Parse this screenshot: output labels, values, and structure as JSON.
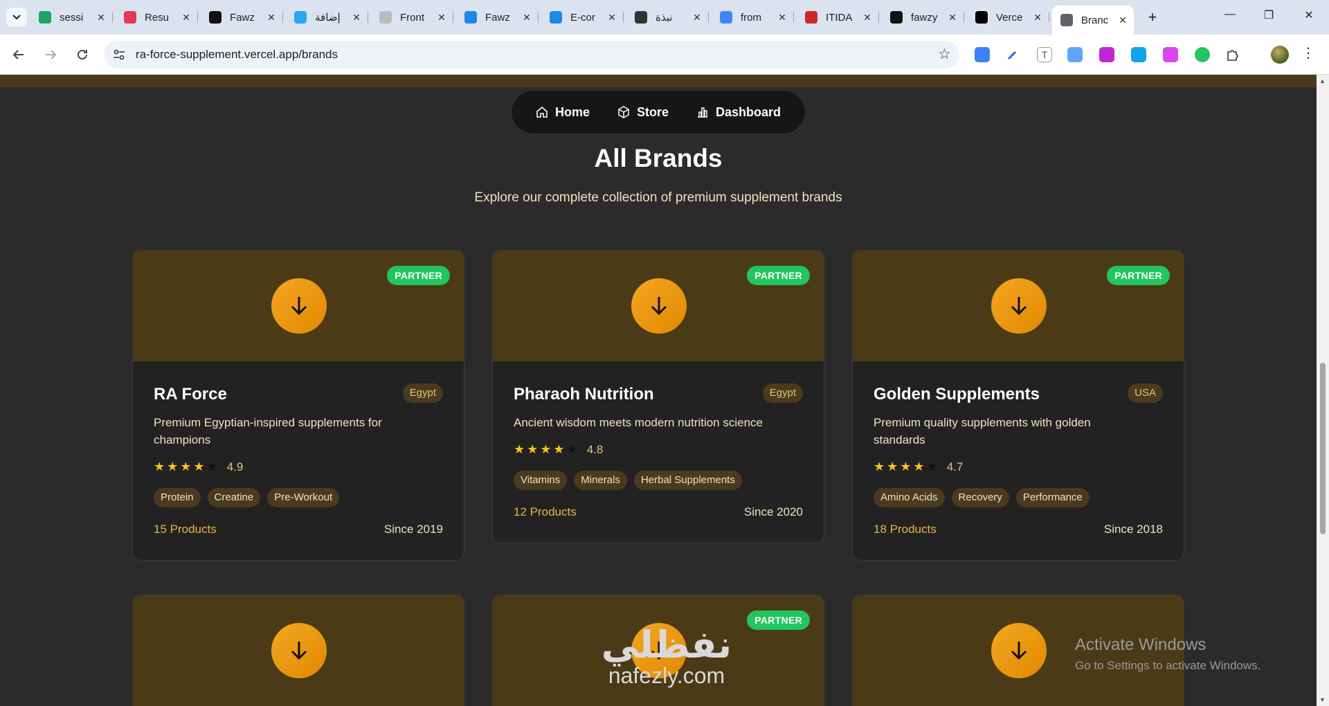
{
  "browser": {
    "tabs": [
      {
        "title": "sessi",
        "icon": "google-drive-icon",
        "color": "#1fa463"
      },
      {
        "title": "Resu",
        "icon": "resume-icon",
        "color": "#e53955"
      },
      {
        "title": "Fawz",
        "icon": "upwork-icon",
        "color": "#111111"
      },
      {
        "title": "إضافة",
        "icon": "circle-icon",
        "color": "#2aa7f0"
      },
      {
        "title": "Front",
        "icon": "page-icon",
        "color": "#bbbbbb"
      },
      {
        "title": "Fawz",
        "icon": "wuzzuf-icon",
        "color": "#1e88e5"
      },
      {
        "title": "E-cor",
        "icon": "wuzzuf-icon",
        "color": "#1e88e5"
      },
      {
        "title": "نبذة",
        "icon": "chatgpt-icon",
        "color": "#333333"
      },
      {
        "title": "from",
        "icon": "google-icon",
        "color": "#4285f4"
      },
      {
        "title": "ITIDA",
        "icon": "itida-icon",
        "color": "#cc2a2a"
      },
      {
        "title": "fawzy",
        "icon": "github-icon",
        "color": "#111111"
      },
      {
        "title": "Verce",
        "icon": "vercel-icon",
        "color": "#000000"
      },
      {
        "title": "Branc",
        "icon": "globe-icon",
        "color": "#5f6368"
      }
    ],
    "url": "ra-force-supplement.vercel.app/brands"
  },
  "nav": {
    "home": "Home",
    "store": "Store",
    "dashboard": "Dashboard"
  },
  "page": {
    "title": "All Brands",
    "subtitle": "Explore our complete collection of premium supplement brands"
  },
  "brands": [
    {
      "name": "RA Force",
      "badge": "PARTNER",
      "country": "Egypt",
      "description": "Premium Egyptian-inspired supplements for champions",
      "rating": "4.9",
      "tags": [
        "Protein",
        "Creatine",
        "Pre-Workout"
      ],
      "products": "15 Products",
      "since": "Since 2019"
    },
    {
      "name": "Pharaoh Nutrition",
      "badge": "PARTNER",
      "country": "Egypt",
      "description": "Ancient wisdom meets modern nutrition science",
      "rating": "4.8",
      "tags": [
        "Vitamins",
        "Minerals",
        "Herbal Supplements"
      ],
      "products": "12 Products",
      "since": "Since 2020"
    },
    {
      "name": "Golden Supplements",
      "badge": "PARTNER",
      "country": "USA",
      "description": "Premium quality supplements with golden standards",
      "rating": "4.7",
      "tags": [
        "Amino Acids",
        "Recovery",
        "Performance"
      ],
      "products": "18 Products",
      "since": "Since 2018"
    }
  ],
  "row2_badge": "PARTNER",
  "windows": {
    "activate_title": "Activate Windows",
    "activate_sub": "Go to Settings to activate Windows."
  },
  "watermark": {
    "arabic": "نفظلي",
    "latin": "nafezly.com"
  }
}
